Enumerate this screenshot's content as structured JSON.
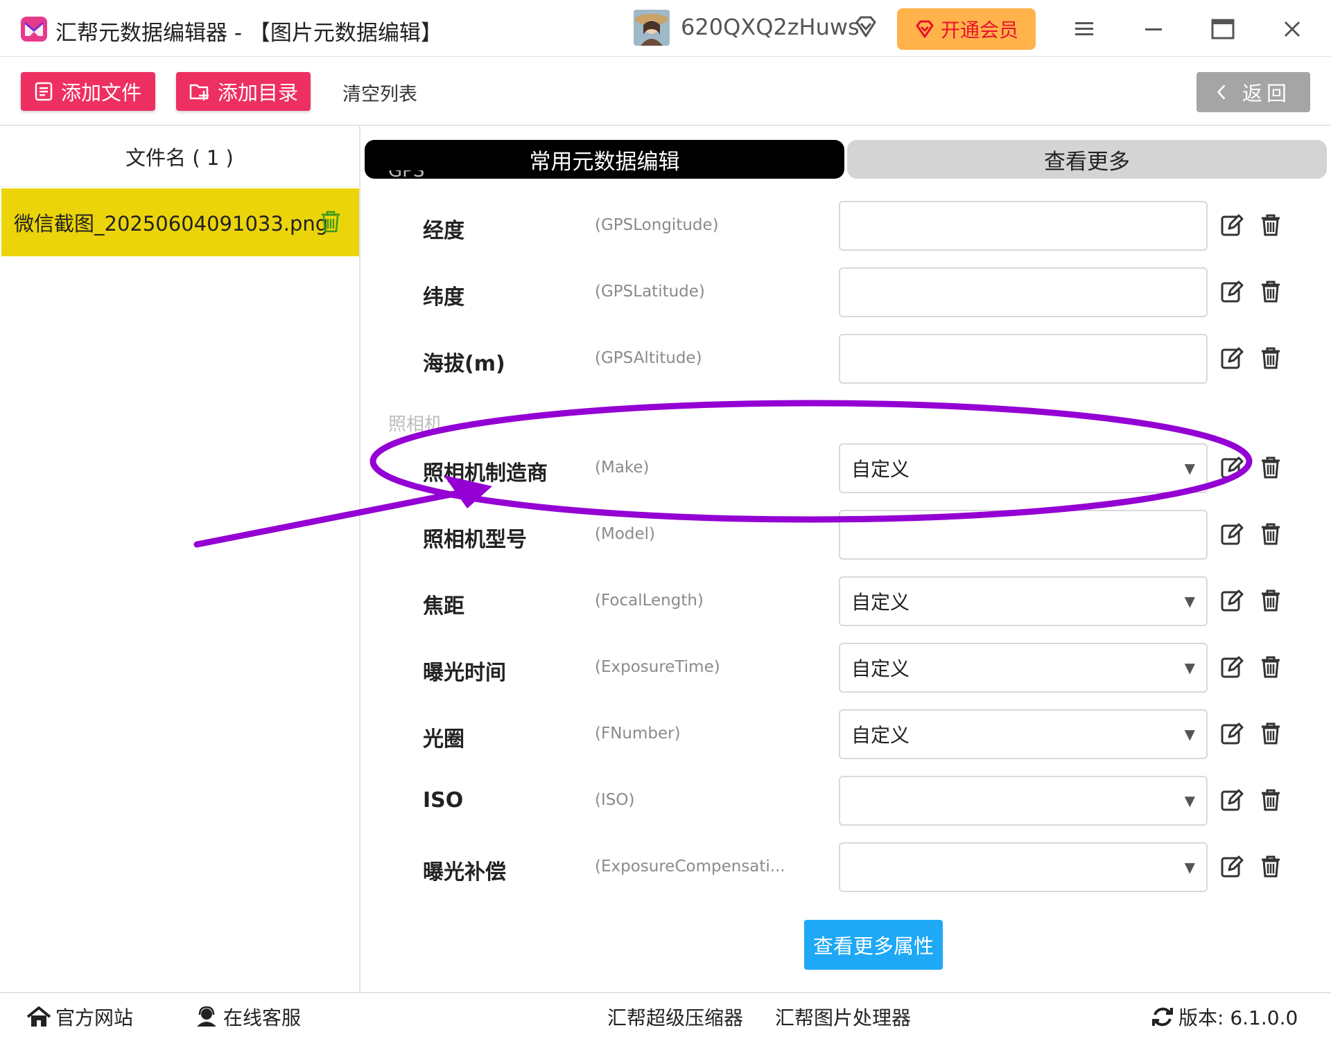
{
  "window": {
    "title": "汇帮元数据编辑器 - 【图片元数据编辑】",
    "username": "620QXQ2zHuws",
    "vip_label": "开通会员",
    "brand_color": "#ee2f61",
    "vip_color": "#ffb34a"
  },
  "toolbar": {
    "add_file": "添加文件",
    "add_dir": "添加目录",
    "clear_list": "清空列表",
    "back": "返回"
  },
  "file_list": {
    "header": "文件名 ( 1 )",
    "files": [
      "微信截图_20250604091033.png"
    ],
    "selected_color": "#ecd40a"
  },
  "tabs": [
    "常用元数据编辑",
    "查看更多"
  ],
  "sections": {
    "gps": "GPS",
    "camera": "照相机"
  },
  "fields": [
    {
      "label": "经度",
      "tag": "(GPSLongitude)",
      "value": "",
      "dropdown": false
    },
    {
      "label": "纬度",
      "tag": "(GPSLatitude)",
      "value": "",
      "dropdown": false
    },
    {
      "label": "海拔(m)",
      "tag": "(GPSAltitude)",
      "value": "",
      "dropdown": false
    },
    {
      "label": "照相机制造商",
      "tag": "(Make)",
      "value": "自定义",
      "dropdown": true
    },
    {
      "label": "照相机型号",
      "tag": "(Model)",
      "value": "",
      "dropdown": false
    },
    {
      "label": "焦距",
      "tag": "(FocalLength)",
      "value": "自定义",
      "dropdown": true
    },
    {
      "label": "曝光时间",
      "tag": "(ExposureTime)",
      "value": "自定义",
      "dropdown": true
    },
    {
      "label": "光圈",
      "tag": "(FNumber)",
      "value": "自定义",
      "dropdown": true
    },
    {
      "label": "ISO",
      "tag": "(ISO)",
      "value": "",
      "dropdown": true
    },
    {
      "label": "曝光补偿",
      "tag": "(ExposureCompensati...",
      "value": "",
      "dropdown": true
    }
  ],
  "more_attrs": "查看更多属性",
  "statusbar": {
    "website": "官方网站",
    "support": "在线客服",
    "compressor": "汇帮超级压缩器",
    "image_processor": "汇帮图片处理器",
    "version": "版本: 6.1.0.0"
  },
  "annotation": {
    "color": "#9400d3",
    "icons": [
      "ellipse-highlight",
      "arrow-pointer"
    ]
  }
}
